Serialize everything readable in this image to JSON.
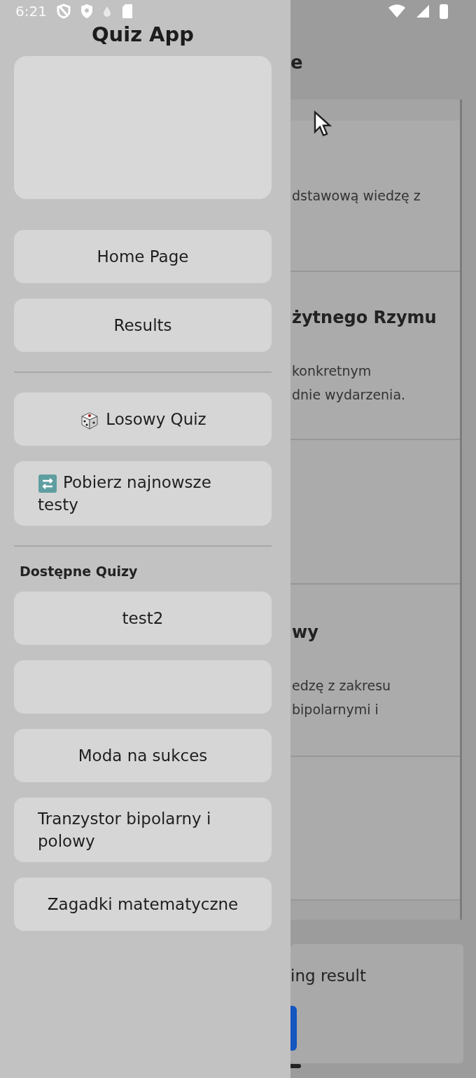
{
  "status_bar": {
    "time": "6:21"
  },
  "background": {
    "title": "e",
    "cards": [
      {
        "kind": "text",
        "lines": [
          "dstawową wiedzę z"
        ]
      },
      {
        "kind": "text",
        "title": "żytnego Rzymu",
        "lines": [
          "konkretnym",
          "dnie wydarzenia."
        ]
      },
      {
        "kind": "blank"
      },
      {
        "kind": "text",
        "title": "wy",
        "lines": [
          "edzę z zakresu",
          "bipolarnymi i"
        ]
      },
      {
        "kind": "blank"
      }
    ],
    "result_card": {
      "text": "ing result"
    }
  },
  "drawer": {
    "title": "Quiz App",
    "nav": [
      {
        "label": "Home Page"
      },
      {
        "label": "Results"
      }
    ],
    "actions": [
      {
        "label": "Losowy Quiz"
      },
      {
        "label": "Pobierz najnowsze testy"
      }
    ],
    "section_title": "Dostępne Quizy",
    "quizzes": [
      {
        "kind": "labeled",
        "label": "test2"
      },
      {
        "kind": "blank"
      },
      {
        "kind": "labeled",
        "label": "Moda na sukces"
      },
      {
        "kind": "labeled",
        "label": "Tranzystor bipolarny i polowy"
      },
      {
        "kind": "labeled",
        "label": "Zagadki matematyczne"
      }
    ]
  }
}
